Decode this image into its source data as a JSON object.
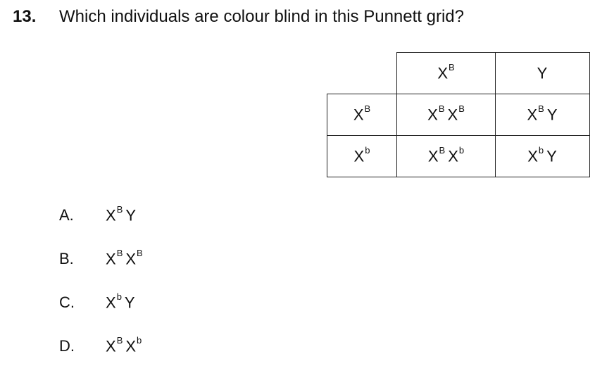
{
  "question": {
    "number": "13.",
    "text": "Which individuals are colour blind in this Punnett grid?"
  },
  "punnett": {
    "column_headers": [
      {
        "base": "X",
        "sup": "B"
      },
      {
        "base": "Y",
        "sup": ""
      }
    ],
    "rows": [
      {
        "header": {
          "base": "X",
          "sup": "B"
        },
        "cells": [
          [
            {
              "base": "X",
              "sup": "B"
            },
            {
              "base": "X",
              "sup": "B"
            }
          ],
          [
            {
              "base": "X",
              "sup": "B"
            },
            {
              "base": "Y",
              "sup": ""
            }
          ]
        ]
      },
      {
        "header": {
          "base": "X",
          "sup": "b"
        },
        "cells": [
          [
            {
              "base": "X",
              "sup": "B"
            },
            {
              "base": "X",
              "sup": "b"
            }
          ],
          [
            {
              "base": "X",
              "sup": "b"
            },
            {
              "base": "Y",
              "sup": ""
            }
          ]
        ]
      }
    ]
  },
  "options": [
    {
      "letter": "A.",
      "genotype": [
        {
          "base": "X",
          "sup": "B"
        },
        {
          "base": "Y",
          "sup": ""
        }
      ]
    },
    {
      "letter": "B.",
      "genotype": [
        {
          "base": "X",
          "sup": "B"
        },
        {
          "base": "X",
          "sup": "B"
        }
      ]
    },
    {
      "letter": "C.",
      "genotype": [
        {
          "base": "X",
          "sup": "b"
        },
        {
          "base": "Y",
          "sup": ""
        }
      ]
    },
    {
      "letter": "D.",
      "genotype": [
        {
          "base": "X",
          "sup": "B"
        },
        {
          "base": "X",
          "sup": "b"
        }
      ]
    }
  ]
}
